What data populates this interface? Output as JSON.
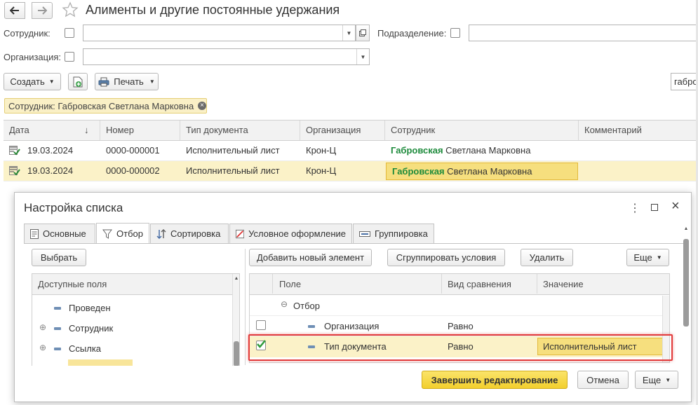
{
  "window": {
    "title": "Алименты и другие постоянные удержания",
    "back_icon": "arrow-left-icon",
    "forward_icon": "arrow-right-icon",
    "favorite_icon": "star-icon"
  },
  "filters": {
    "employee_label": "Сотрудник:",
    "employee_value": "",
    "department_label": "Подразделение:",
    "department_value": "",
    "organization_label": "Организация:",
    "organization_value": ""
  },
  "toolbar": {
    "create_label": "Создать",
    "print_label": "Печать",
    "search_value": "габро"
  },
  "filter_tag": {
    "text": "Сотрудник: Габровская Светлана Марковна"
  },
  "grid": {
    "columns": [
      "Дата",
      "Номер",
      "Тип документа",
      "Организация",
      "Сотрудник",
      "Комментарий"
    ],
    "sort_indicator": "↓",
    "rows": [
      {
        "date": "19.03.2024",
        "number": "0000-000001",
        "doc_type": "Исполнительный лист",
        "organization": "Крон-Ц",
        "employee_match": "Габровская",
        "employee_rest": " Светлана Марковна",
        "comment": ""
      },
      {
        "date": "19.03.2024",
        "number": "0000-000002",
        "doc_type": "Исполнительный лист",
        "organization": "Крон-Ц",
        "employee_match": "Габровская",
        "employee_rest": " Светлана Марковна",
        "comment": ""
      }
    ]
  },
  "dialog": {
    "title": "Настройка списка",
    "tabs": [
      "Основные",
      "Отбор",
      "Сортировка",
      "Условное оформление",
      "Группировка"
    ],
    "active_tab": "Отбор",
    "select_button": "Выбрать",
    "available_fields_header": "Доступные поля",
    "available_fields": [
      {
        "label": "Проведен",
        "expandable": false
      },
      {
        "label": "Сотрудник",
        "expandable": true
      },
      {
        "label": "Ссылка",
        "expandable": true
      }
    ],
    "add_element_button": "Добавить новый элемент",
    "group_conditions_button": "Сгруппировать условия",
    "delete_button": "Удалить",
    "more_button": "Еще",
    "filter_columns": [
      "Поле",
      "Вид сравнения",
      "Значение"
    ],
    "filter_group": "Отбор",
    "filter_rows": [
      {
        "checked": false,
        "field": "Организация",
        "comparison": "Равно",
        "value": ""
      },
      {
        "checked": true,
        "field": "Тип документа",
        "comparison": "Равно",
        "value": "Исполнительный лист"
      }
    ],
    "finish_button": "Завершить редактирование",
    "cancel_button": "Отмена",
    "footer_more_button": "Еще"
  },
  "colors": {
    "accent_yellow": "#f6d955",
    "selected_row": "#fbf2c8",
    "highlight_cell": "#f6df7e",
    "match_green": "#1e8b3c",
    "callout_red": "#e23a3a",
    "filter_tag_bg": "#faf0c6"
  }
}
